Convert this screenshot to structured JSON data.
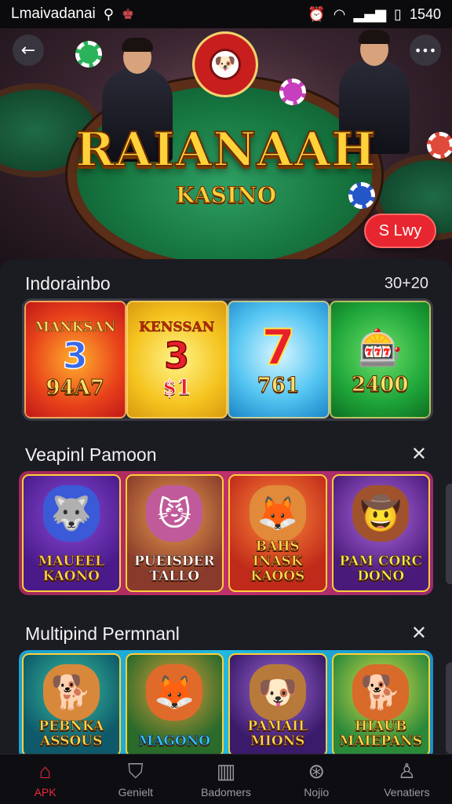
{
  "status_bar": {
    "carrier": "Lmaivadanai",
    "time": "1540"
  },
  "hero": {
    "title": "RAIANAAH",
    "subtitle": "KASINO",
    "play_label": "S Lwy"
  },
  "section1": {
    "title": "Indorainbo",
    "right_text": "30+20",
    "tiles": [
      {
        "name": "MANKSAN",
        "big": "3",
        "amount": "94A7"
      },
      {
        "name": "KENSSAN",
        "big": "3",
        "amount": "$1"
      },
      {
        "name": "",
        "big": "7",
        "amount": "761"
      },
      {
        "name": "",
        "big": "",
        "amount": "2400"
      }
    ]
  },
  "section2": {
    "title": "Veapinl Pamoon",
    "tiles": [
      {
        "name": "MAUEEL KAONO"
      },
      {
        "name": "PUEISDER TALLO"
      },
      {
        "name": "BAHS INASK KAOOS"
      },
      {
        "name": "PAM CORC DONO"
      }
    ]
  },
  "section3": {
    "title": "Multipind Permnanl",
    "tiles": [
      {
        "name": "PEBNKA ASSOUS"
      },
      {
        "name": "MAGONO"
      },
      {
        "name": "PAMAIL MIONS"
      },
      {
        "name": "HIAUB MAIEPANS"
      }
    ]
  },
  "nav": [
    {
      "label": "APK",
      "icon": "home-icon"
    },
    {
      "label": "Genielt",
      "icon": "shield-icon"
    },
    {
      "label": "Badomers",
      "icon": "chart-icon"
    },
    {
      "label": "Nojio",
      "icon": "compass-icon"
    },
    {
      "label": "Venatiers",
      "icon": "person-icon"
    }
  ]
}
